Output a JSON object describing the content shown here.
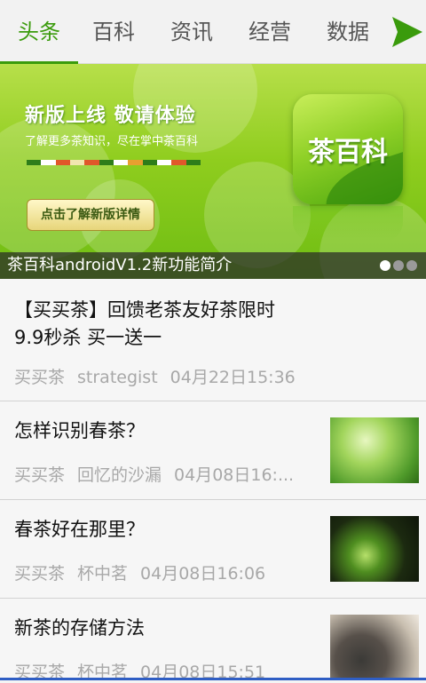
{
  "tabs": [
    {
      "label": "头条",
      "active": true
    },
    {
      "label": "百科",
      "active": false
    },
    {
      "label": "资讯",
      "active": false
    },
    {
      "label": "经营",
      "active": false
    },
    {
      "label": "数据",
      "active": false
    }
  ],
  "more_icon": "arrow-right-icon",
  "colors": {
    "accent": "#3a9b0c",
    "banner_green": "#8fcd1e",
    "meta_gray": "#a8a8a8"
  },
  "banner": {
    "promo_title": "新版上线  敬请体验",
    "promo_subtitle": "了解更多茶知识，尽在掌中茶百科",
    "promo_button": "点击了解新版详情",
    "logo_text": "茶百科",
    "caption": "茶百科androidV1.2新功能简介",
    "page_count": 3,
    "current_page": 1
  },
  "news": [
    {
      "title": "【买买茶】回馈老茶友好茶限时9.9秒杀 买一送一",
      "source": "买买茶",
      "author": "strategist",
      "time": "04月22日15:36",
      "thumb": null
    },
    {
      "title": "怎样识别春茶？",
      "source": "买买茶",
      "author": "回忆的沙漏",
      "time": "04月08日16:...",
      "thumb": "tea-leaf-image"
    },
    {
      "title": "春茶好在那里？",
      "source": "买买茶",
      "author": "杯中茗",
      "time": "04月08日16:06",
      "thumb": "tea-sprout-image"
    },
    {
      "title": "新茶的存储方法",
      "source": "买买茶",
      "author": "杯中茗",
      "time": "04月08日15:51",
      "thumb": "tea-ware-image"
    }
  ]
}
